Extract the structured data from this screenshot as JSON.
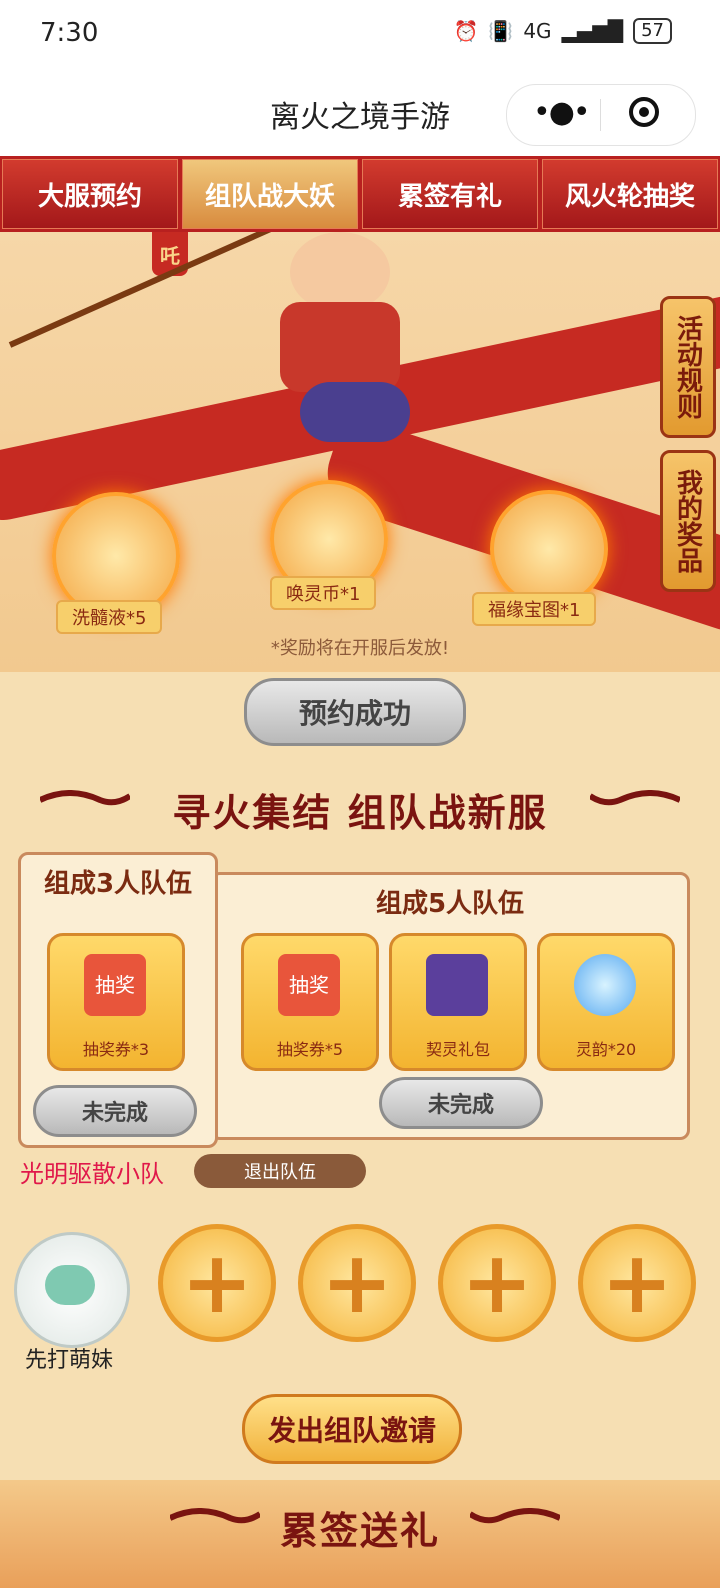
{
  "status_bar": {
    "time": "7:30",
    "signal_text": "4G",
    "battery": "57"
  },
  "title_bar": {
    "title": "离火之境手游"
  },
  "tabs": [
    {
      "label": "大服预约"
    },
    {
      "label": "组队战大妖"
    },
    {
      "label": "累签有礼"
    },
    {
      "label": "风火轮抽奖"
    }
  ],
  "side_buttons": {
    "rules": "活动规则",
    "my_prizes": "我的奖品"
  },
  "hero_tag": "吒",
  "rewards_preview": [
    {
      "label": "洗髓液*5"
    },
    {
      "label": "唤灵币*1"
    },
    {
      "label": "福缘宝图*1"
    }
  ],
  "notice": "*奖励将在开服后发放!",
  "reserve_status": "预约成功",
  "section1_title": "寻火集结 组队战新服",
  "team3": {
    "title": "组成3人队伍",
    "reward": {
      "label": "抽奖券*3",
      "icon_text": "抽奖"
    },
    "status": "未完成"
  },
  "team5": {
    "title": "组成5人队伍",
    "rewards": [
      {
        "label": "抽奖券*5",
        "icon_text": "抽奖"
      },
      {
        "label": "契灵礼包"
      },
      {
        "label": "灵韵*20"
      }
    ],
    "status": "未完成"
  },
  "team": {
    "name": "光明驱散小队",
    "quit": "退出队伍",
    "leader": "先打萌妹",
    "add_symbol": "+"
  },
  "invite": "发出组队邀请",
  "section2_title": "累签送礼"
}
